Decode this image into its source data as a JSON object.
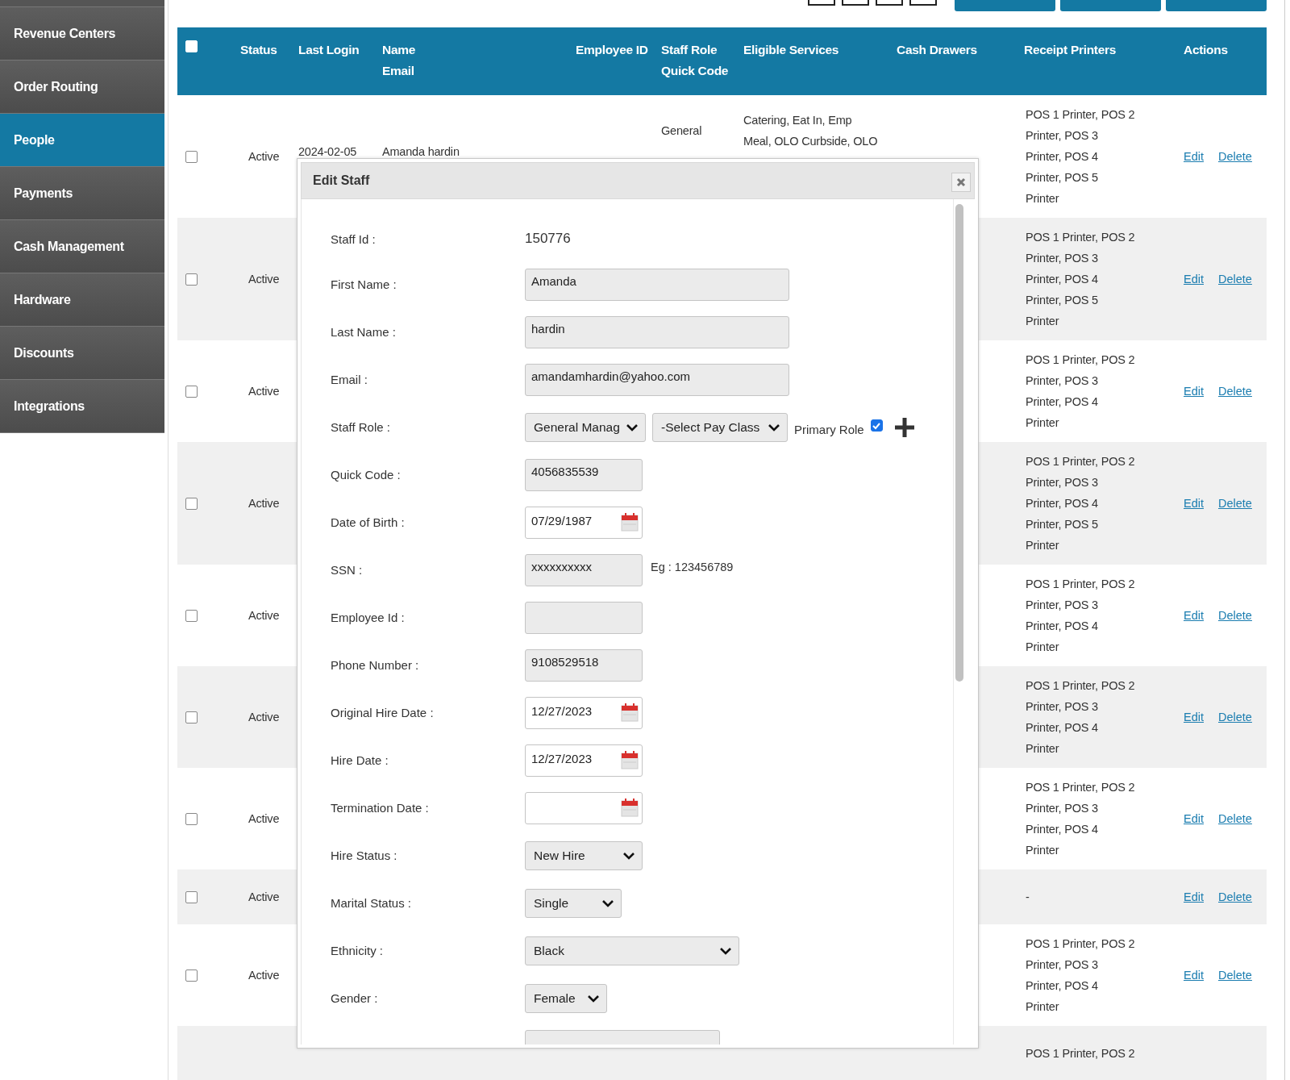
{
  "sidebar": {
    "items": [
      {
        "label": "Revenue Centers",
        "selected": false
      },
      {
        "label": "Order Routing",
        "selected": false
      },
      {
        "label": "People",
        "selected": true
      },
      {
        "label": "Payments",
        "selected": false
      },
      {
        "label": "Cash Management",
        "selected": false
      },
      {
        "label": "Hardware",
        "selected": false
      },
      {
        "label": "Discounts",
        "selected": false
      },
      {
        "label": "Integrations",
        "selected": false
      }
    ]
  },
  "table": {
    "header_checkbox": {
      "checked": false
    },
    "columns": [
      {
        "lines": [
          "Status"
        ]
      },
      {
        "lines": [
          "Last Login"
        ]
      },
      {
        "lines": [
          "Name",
          "Email"
        ]
      },
      {
        "lines": [
          "Employee ID"
        ]
      },
      {
        "lines": [
          "Staff Role",
          "Quick Code"
        ]
      },
      {
        "lines": [
          "Eligible Services"
        ]
      },
      {
        "lines": [
          "Cash Drawers"
        ]
      },
      {
        "lines": [
          "Receipt Printers"
        ]
      },
      {
        "lines": [
          "Actions"
        ]
      }
    ],
    "rows": [
      {
        "checked": false,
        "status": "Active",
        "last_login": "2024-02-05",
        "name": "Amanda hardin",
        "staff_role": "General",
        "eligible_services": [
          "Catering, Eat In, Emp",
          "Meal, OLO Curbside, OLO"
        ],
        "receipt_printers": [
          "POS 1 Printer, POS 2",
          "Printer, POS 3",
          "Printer, POS 4",
          "Printer, POS 5",
          "Printer"
        ],
        "actions": [
          "Edit",
          "Delete"
        ]
      },
      {
        "checked": false,
        "status": "Active",
        "receipt_printers": [
          "POS 1 Printer, POS 2",
          "Printer, POS 3",
          "Printer, POS 4",
          "Printer, POS 5",
          "Printer"
        ],
        "actions": [
          "Edit",
          "Delete"
        ]
      },
      {
        "checked": false,
        "status": "Active",
        "receipt_printers": [
          "POS 1 Printer, POS 2",
          "Printer, POS 3",
          "Printer, POS 4",
          "Printer"
        ],
        "actions": [
          "Edit",
          "Delete"
        ]
      },
      {
        "checked": false,
        "status": "Active",
        "receipt_printers": [
          "POS 1 Printer, POS 2",
          "Printer, POS 3",
          "Printer, POS 4",
          "Printer, POS 5",
          "Printer"
        ],
        "actions": [
          "Edit",
          "Delete"
        ]
      },
      {
        "checked": false,
        "status": "Active",
        "receipt_printers": [
          "POS 1 Printer, POS 2",
          "Printer, POS 3",
          "Printer, POS 4",
          "Printer"
        ],
        "actions": [
          "Edit",
          "Delete"
        ]
      },
      {
        "checked": false,
        "status": "Active",
        "receipt_printers": [
          "POS 1 Printer, POS 2",
          "Printer, POS 3",
          "Printer, POS 4",
          "Printer"
        ],
        "actions": [
          "Edit",
          "Delete"
        ]
      },
      {
        "checked": false,
        "status": "Active",
        "receipt_printers": [
          "POS 1 Printer, POS 2",
          "Printer, POS 3",
          "Printer, POS 4",
          "Printer"
        ],
        "actions": [
          "Edit",
          "Delete"
        ]
      },
      {
        "checked": false,
        "status": "Active",
        "receipt_printers": [
          "-"
        ],
        "actions": [
          "Edit",
          "Delete"
        ]
      },
      {
        "checked": false,
        "status": "Active",
        "receipt_printers": [
          "POS 1 Printer, POS 2",
          "Printer, POS 3",
          "Printer, POS 4",
          "Printer"
        ],
        "actions": [
          "Edit",
          "Delete"
        ]
      },
      {
        "receipt_printers": [
          "POS 1 Printer, POS 2"
        ]
      }
    ]
  },
  "dialog": {
    "title": "Edit Staff",
    "fields": [
      {
        "kind": "static",
        "label": "Staff Id :",
        "value": "150776"
      },
      {
        "kind": "text",
        "label": "First Name :",
        "value": "Amanda"
      },
      {
        "kind": "text",
        "label": "Last Name :",
        "value": "hardin"
      },
      {
        "kind": "text",
        "label": "Email :",
        "value": "amandamhardin@yahoo.com"
      },
      {
        "kind": "role",
        "label": "Staff Role :",
        "value": "General Manag",
        "pay_class": "-Select Pay Class",
        "primary_label": "Primary Role",
        "primary": true
      },
      {
        "kind": "text",
        "label": "Quick Code :",
        "value": "4056835539"
      },
      {
        "kind": "date",
        "label": "Date of Birth :",
        "value": "07/29/1987"
      },
      {
        "kind": "text",
        "label": "SSN :",
        "value": "xxxxxxxxxx",
        "hint": "Eg : 123456789"
      },
      {
        "kind": "text",
        "label": "Employee Id :"
      },
      {
        "kind": "text",
        "label": "Phone Number :",
        "value": "9108529518"
      },
      {
        "kind": "date",
        "label": "Original Hire Date :",
        "value": "12/27/2023"
      },
      {
        "kind": "date",
        "label": "Hire Date :",
        "value": "12/27/2023"
      },
      {
        "kind": "date",
        "label": "Termination Date :"
      },
      {
        "kind": "select",
        "label": "Hire Status :",
        "value": "New Hire"
      },
      {
        "kind": "select",
        "label": "Marital Status :",
        "value": "Single"
      },
      {
        "kind": "select",
        "label": "Ethnicity :",
        "value": "Black"
      },
      {
        "kind": "select",
        "label": "Gender :",
        "value": "Female"
      },
      {
        "kind": "text"
      }
    ]
  }
}
